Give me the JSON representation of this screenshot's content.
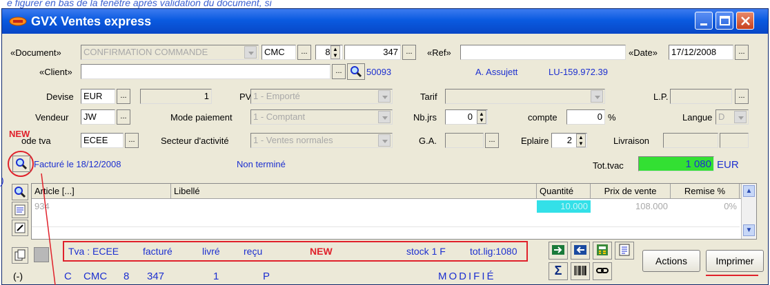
{
  "top_note": "e figurer en bas de la fenêtre après validation du document, si",
  "app": {
    "title": "GVX  Ventes express"
  },
  "header": {
    "document_label": "«Document»",
    "document_value": "CONFIRMATION COMMANDE",
    "doc_code": "CMC",
    "doc_series": "8",
    "doc_number": "347",
    "ref_label": "«Ref»",
    "ref_value": "",
    "date_label": "«Date»",
    "date_value": "17/12/2008",
    "client_label": "«Client»",
    "client_value": "",
    "client_number": "50093",
    "client_type": "A. Assujett",
    "vat_number": "LU-159.972.39",
    "devise_label": "Devise",
    "devise_value": "EUR",
    "devise_rate": "1",
    "pv_label": "PV",
    "pv_value": "1 - Emporté",
    "tarif_label": "Tarif",
    "lp_label": "L.P.",
    "vendeur_label": "Vendeur",
    "vendeur_value": "JW",
    "mode_paiement_label": "Mode paiement",
    "mode_paiement_value": "1 - Comptant",
    "nbjrs_label": "Nb.jrs",
    "nbjrs_value": "0",
    "compte_label": "compte",
    "compte_value": "0",
    "percent_sign": "%",
    "langue_label": "Langue",
    "langue_value": "D",
    "new_label": "NEW",
    "code_tva_label": "ode tva",
    "code_tva_value": "ECEE",
    "secteur_label": "Secteur d'activité",
    "secteur_value": "1 - Ventes normales",
    "ga_label": "G.A.",
    "eplaire_label": "Eplaire",
    "eplaire_value": "2",
    "livraison_label": "Livraison",
    "facture_text": "Facturé le 18/12/2008",
    "status_text": "Non terminé",
    "tot_label": "Tot.tvac",
    "tot_value": "1 080",
    "tot_currency": "EUR",
    "left_marker": ")"
  },
  "grid": {
    "columns": [
      "Article [...]",
      "Libellé",
      "Quantité",
      "Prix de vente",
      "Remise %"
    ],
    "rows": [
      {
        "article": "934",
        "libelle": "",
        "quantite": "10.000",
        "prix": "108.000",
        "remise": "0%"
      }
    ]
  },
  "status_bar": {
    "tva": "Tva : ECEE",
    "facture": "facturé",
    "livre": "livré",
    "recu": "reçu",
    "new": "NEW",
    "stock": "stock 1  F",
    "totlig": "tot.lig:1080"
  },
  "bottom_bar": {
    "c": "C",
    "code": "CMC",
    "series": "8",
    "number": "347",
    "one": "1",
    "p": "P",
    "modifie": "MODIFIÉ",
    "marker": "(-)"
  },
  "buttons": {
    "actions": "Actions",
    "imprimer": "Imprimer"
  },
  "colors": {
    "title_bar": "#0a5ae0",
    "accent_red": "#e0202a",
    "total_bg": "#33e033",
    "qty_bg": "#33e0e8",
    "link_blue": "#1c2fd0",
    "modified_green": "#0a8a14"
  }
}
